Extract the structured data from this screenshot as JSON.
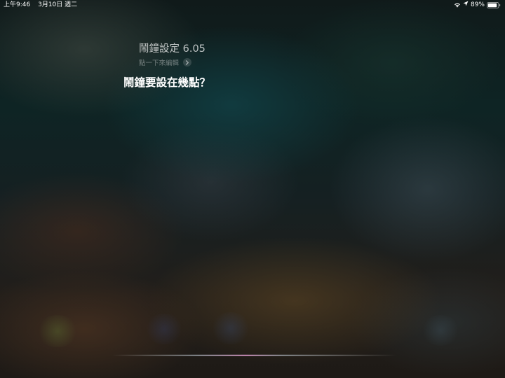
{
  "status_bar": {
    "time": "上午9:46",
    "date": "3月10日 週二",
    "battery_percent_label": "89%",
    "battery_level": 0.89,
    "icons": [
      "wifi-icon",
      "location-arrow-icon",
      "battery-icon"
    ]
  },
  "siri": {
    "request_text": "鬧鐘設定 6.05",
    "edit_hint": "點一下來編輯",
    "edit_icon": "chevron-right-icon",
    "response_text": "鬧鐘要設在幾點？",
    "waveform_icon": "siri-waveform"
  },
  "colors": {
    "text_primary": "#ffffff",
    "waveform_accent": "#f6a8e2",
    "background_top": "#0e2424",
    "background_bottom": "#221e1a"
  }
}
